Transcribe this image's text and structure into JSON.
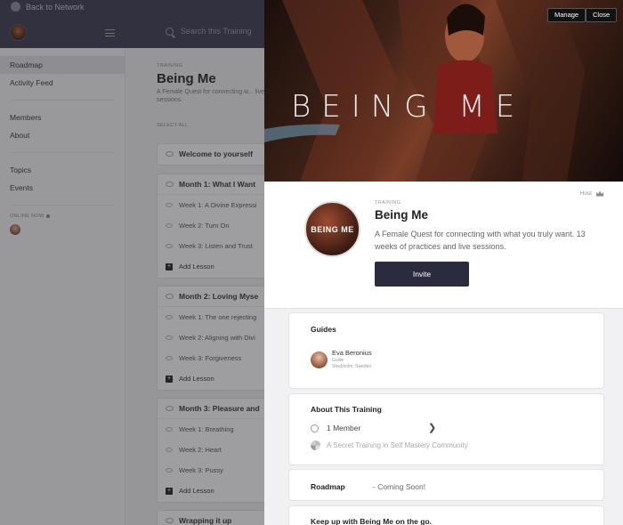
{
  "topbar": {
    "back_label": "Back to Network",
    "search_placeholder": "Search this Training"
  },
  "sidebar": {
    "items": [
      {
        "label": "Roadmap"
      },
      {
        "label": "Activity Feed"
      },
      {
        "label": "Members"
      },
      {
        "label": "About"
      },
      {
        "label": "Topics"
      },
      {
        "label": "Events"
      }
    ],
    "online_label": "ONLINE NOW"
  },
  "content": {
    "kicker": "TRAINING",
    "title": "Being Me",
    "description": "A Female Quest for connecting w... live sessions.",
    "select_all": "SELECT ALL",
    "sections": [
      {
        "title": "Welcome to yourself",
        "lessons": []
      },
      {
        "title": "Month 1: What I Want",
        "lessons": [
          "Week 1: A Divine Expressi",
          "Week 2: Turn On",
          "Week 3: Listen and Trust"
        ],
        "add": "Add Lesson"
      },
      {
        "title": "Month 2: Loving Myse",
        "lessons": [
          "Week 1: The one rejecting",
          "Week 2: Aligning with Divi",
          "Week 3: Forgiveness"
        ],
        "add": "Add Lesson"
      },
      {
        "title": "Month 3: Pleasure and",
        "lessons": [
          "Week 1: Breathing",
          "Week 2: Heart",
          "Week 3: Pussy"
        ],
        "add": "Add Lesson"
      },
      {
        "title": "Wrapping it up",
        "lessons": []
      }
    ]
  },
  "panel": {
    "hero_title": "BEING ME",
    "manage_label": "Manage",
    "close_label": "Close",
    "host_label": "Host",
    "avatar_text": "BEING ME",
    "kicker": "TRAINING",
    "title": "Being Me",
    "description": "A Female Quest for connecting with what you truly want. 13 weeks of practices and live sessions.",
    "invite_label": "Invite",
    "guides": {
      "title": "Guides",
      "name": "Eva Beronius",
      "role": "Guide",
      "location": "Stockholm, Sweden"
    },
    "about": {
      "title": "About This Training",
      "members": "1 Member",
      "chevron": "❯",
      "community": "A Secret Training in Self Mastery Community"
    },
    "roadmap": {
      "title": "Roadmap",
      "status": "- Coming Soon!"
    },
    "keepup": {
      "title": "Keep up with Being Me on the go."
    }
  }
}
